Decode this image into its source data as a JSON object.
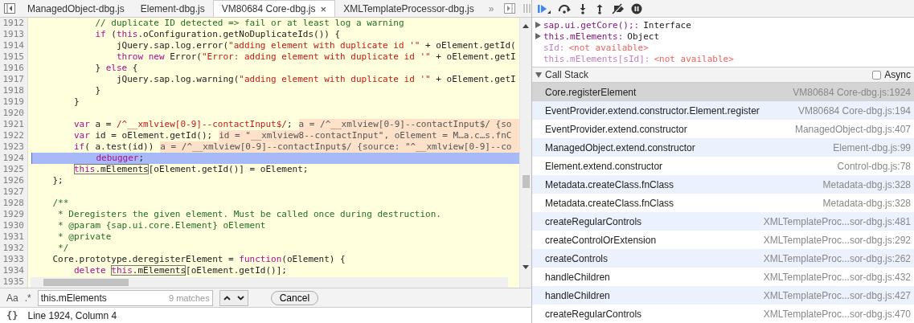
{
  "tabs": [
    {
      "label": "ManagedObject-dbg.js",
      "selected": false
    },
    {
      "label": "Element-dbg.js",
      "selected": false
    },
    {
      "label": "VM80684 Core-dbg.js",
      "selected": true,
      "close": "×"
    },
    {
      "label": "XMLTemplateProcessor-dbg.js",
      "selected": false
    }
  ],
  "tab_overflow": "»",
  "editor": {
    "lines": [
      {
        "number": "1912",
        "segments": [
          {
            "kind": "comment",
            "text": "            // duplicate ID detected => fail or at least log a warning"
          }
        ]
      },
      {
        "number": "1913",
        "segments": [
          {
            "kind": "keyword",
            "text": "            if"
          },
          {
            "kind": "plain",
            "text": " ("
          },
          {
            "kind": "keyword",
            "text": "this"
          },
          {
            "kind": "plain",
            "text": ".oConfiguration.getNoDuplicateIds()) {"
          }
        ]
      },
      {
        "number": "1914",
        "segments": [
          {
            "kind": "plain",
            "text": "                jQuery.sap.log.error("
          },
          {
            "kind": "string",
            "text": "\"adding element with duplicate id '\""
          },
          {
            "kind": "plain",
            "text": " + oElement.getId("
          }
        ]
      },
      {
        "number": "1915",
        "segments": [
          {
            "kind": "keyword",
            "text": "                throw new"
          },
          {
            "kind": "plain",
            "text": " Error("
          },
          {
            "kind": "string",
            "text": "\"Error: adding element with duplicate id '\""
          },
          {
            "kind": "plain",
            "text": " + oElement.getI"
          }
        ]
      },
      {
        "number": "1916",
        "segments": [
          {
            "kind": "plain",
            "text": "            } "
          },
          {
            "kind": "keyword",
            "text": "else"
          },
          {
            "kind": "plain",
            "text": " {"
          }
        ]
      },
      {
        "number": "1917",
        "segments": [
          {
            "kind": "plain",
            "text": "                jQuery.sap.log.warning("
          },
          {
            "kind": "string",
            "text": "\"adding element with duplicate id '\""
          },
          {
            "kind": "plain",
            "text": " + oElement.getI"
          }
        ]
      },
      {
        "number": "1918",
        "segments": [
          {
            "kind": "plain",
            "text": "            }"
          }
        ]
      },
      {
        "number": "1919",
        "segments": [
          {
            "kind": "plain",
            "text": "        }"
          }
        ]
      },
      {
        "number": "1920"
      },
      {
        "number": "1921",
        "segments": [
          {
            "kind": "keyword",
            "text": "        var"
          },
          {
            "kind": "plain",
            "text": " a = "
          },
          {
            "kind": "string",
            "text": "/^__xmlview[0-9]--contactInput$/"
          },
          {
            "kind": "plain",
            "text": ";"
          }
        ],
        "inline_value": "a = /^__xmlview[0-9]--contactInput$/ {so"
      },
      {
        "number": "1922",
        "segments": [
          {
            "kind": "keyword",
            "text": "        var"
          },
          {
            "kind": "plain",
            "text": " id = oElement.getId();"
          }
        ],
        "inline_value": "id = \"__xmlview8--contactInput\", oElement = M…a.c…s.fnC"
      },
      {
        "number": "1923",
        "segments": [
          {
            "kind": "keyword",
            "text": "        if"
          },
          {
            "kind": "plain",
            "text": "( a.test(id))"
          }
        ],
        "inline_value": "a = /^__xmlview[0-9]--contactInput$/ {source: \"^__xmlview[0-9]--co"
      },
      {
        "number": "1924",
        "current": true,
        "segments": [
          {
            "kind": "keyword",
            "text": "            debugger"
          },
          {
            "kind": "plain",
            "text": ";"
          }
        ]
      },
      {
        "number": "1925",
        "segments": [
          {
            "kind": "match",
            "parts": [
              {
                "kind": "keyword",
                "text": "        this"
              },
              {
                "kind": "plain",
                "text": ".mElements"
              }
            ]
          },
          {
            "kind": "plain",
            "text": "[oElement.getId()] = oElement;"
          }
        ]
      },
      {
        "number": "1926",
        "segments": [
          {
            "kind": "plain",
            "text": "    };"
          }
        ]
      },
      {
        "number": "1927"
      },
      {
        "number": "1928",
        "segments": [
          {
            "kind": "comment",
            "text": "    /**"
          }
        ]
      },
      {
        "number": "1929",
        "segments": [
          {
            "kind": "comment",
            "text": "     * Deregisters the given element. Must be called once during destruction."
          }
        ]
      },
      {
        "number": "1930",
        "segments": [
          {
            "kind": "comment",
            "text": "     * @param {sap.ui.core.Element} oElement"
          }
        ]
      },
      {
        "number": "1931",
        "segments": [
          {
            "kind": "comment",
            "text": "     * @private"
          }
        ]
      },
      {
        "number": "1932",
        "segments": [
          {
            "kind": "comment",
            "text": "     */"
          }
        ]
      },
      {
        "number": "1933",
        "segments": [
          {
            "kind": "plain",
            "text": "    Core.prototype.deregisterElement = "
          },
          {
            "kind": "keyword",
            "text": "function"
          },
          {
            "kind": "plain",
            "text": "(oElement) {"
          }
        ]
      },
      {
        "number": "1934",
        "segments": [
          {
            "kind": "keyword",
            "text": "        delete "
          },
          {
            "kind": "match",
            "parts": [
              {
                "kind": "keyword",
                "text": "this"
              },
              {
                "kind": "plain",
                "text": ".mElements"
              }
            ]
          },
          {
            "kind": "plain",
            "text": "[oElement.getId()];"
          }
        ]
      },
      {
        "number": "1935"
      }
    ]
  },
  "search": {
    "case_toggle": "Aa",
    "regex_toggle": ".*",
    "value": "this.mElements",
    "match_count": "9 matches",
    "cancel": "Cancel"
  },
  "status_bar": {
    "format_icon": "{}",
    "position": "Line 1924, Column 4"
  },
  "watch": [
    {
      "name": "sap.ui.getCore();:",
      "value": "Interface",
      "expandable": true,
      "available": true
    },
    {
      "name": "this.mElements:",
      "value": "Object",
      "expandable": true,
      "available": true
    },
    {
      "name": "sId:",
      "value": "<not available>",
      "expandable": false,
      "available": false
    },
    {
      "name": "this.mElements[sId]:",
      "value": "<not available>",
      "expandable": false,
      "available": false
    }
  ],
  "call_stack": {
    "title": "Call Stack",
    "expanded": true,
    "async": {
      "label": "Async",
      "checked": false
    },
    "frames": [
      {
        "function": "Core.registerElement",
        "location": "VM80684 Core-dbg.js:1924",
        "selected": true
      },
      {
        "function": "EventProvider.extend.constructor.Element.register",
        "location": "VM80684 Core-dbg.js:194",
        "selected": false
      },
      {
        "function": "EventProvider.extend.constructor",
        "location": "ManagedObject-dbg.js:407",
        "selected": false
      },
      {
        "function": "ManagedObject.extend.constructor",
        "location": "Element-dbg.js:99",
        "selected": false
      },
      {
        "function": "Element.extend.constructor",
        "location": "Control-dbg.js:78",
        "selected": false
      },
      {
        "function": "Metadata.createClass.fnClass",
        "location": "Metadata-dbg.js:328",
        "selected": false
      },
      {
        "function": "Metadata.createClass.fnClass",
        "location": "Metadata-dbg.js:328",
        "selected": false
      },
      {
        "function": "createRegularControls",
        "location": "XMLTemplateProc...sor-dbg.js:481",
        "selected": false
      },
      {
        "function": "createControlOrExtension",
        "location": "XMLTemplateProc...sor-dbg.js:292",
        "selected": false
      },
      {
        "function": "createControls",
        "location": "XMLTemplateProc...sor-dbg.js:262",
        "selected": false
      },
      {
        "function": "handleChildren",
        "location": "XMLTemplateProc...sor-dbg.js:432",
        "selected": false
      },
      {
        "function": "handleChildren",
        "location": "XMLTemplateProc...sor-dbg.js:427",
        "selected": false
      },
      {
        "function": "createRegularControls",
        "location": "XMLTemplateProc...sor-dbg.js:470",
        "selected": false
      }
    ]
  }
}
